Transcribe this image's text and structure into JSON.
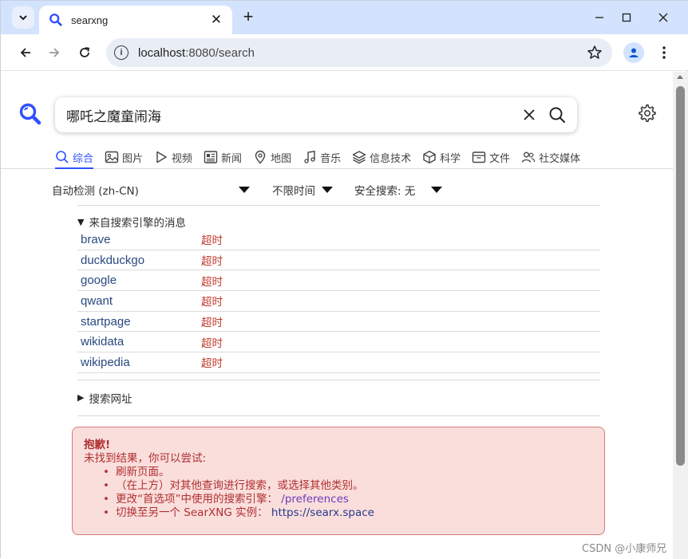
{
  "browser": {
    "tab_title": "searxng",
    "url_host": "localhost",
    "url_rest": ":8080/search"
  },
  "search": {
    "query": "哪吒之魔童闹海"
  },
  "categories": [
    {
      "label": "综合",
      "icon": "search-icon",
      "active": true
    },
    {
      "label": "图片",
      "icon": "image-icon"
    },
    {
      "label": "视频",
      "icon": "play-icon"
    },
    {
      "label": "新闻",
      "icon": "newspaper-icon"
    },
    {
      "label": "地图",
      "icon": "map-pin-icon"
    },
    {
      "label": "音乐",
      "icon": "music-icon"
    },
    {
      "label": "信息技术",
      "icon": "layers-icon"
    },
    {
      "label": "科学",
      "icon": "cube-icon"
    },
    {
      "label": "文件",
      "icon": "file-box-icon"
    },
    {
      "label": "社交媒体",
      "icon": "people-icon"
    }
  ],
  "filters": {
    "language": "自动检测 (zh-CN)",
    "time": "不限时间",
    "safesearch": "安全搜索: 无"
  },
  "engines": {
    "summary": "来自搜索引擎的消息",
    "rows": [
      {
        "name": "brave",
        "status": "超时"
      },
      {
        "name": "duckduckgo",
        "status": "超时"
      },
      {
        "name": "google",
        "status": "超时"
      },
      {
        "name": "qwant",
        "status": "超时"
      },
      {
        "name": "startpage",
        "status": "超时"
      },
      {
        "name": "wikidata",
        "status": "超时"
      },
      {
        "name": "wikipedia",
        "status": "超时"
      }
    ]
  },
  "search_url": {
    "summary": "搜索网址"
  },
  "alert": {
    "title": "抱歉!",
    "subtitle": "未找到结果，你可以尝试:",
    "items": [
      {
        "text": "刷新页面。"
      },
      {
        "text": "（在上方）对其他查询进行搜索，或选择其他类别。"
      },
      {
        "text": "更改“首选项”中使用的搜索引擎：",
        "link": "/preferences"
      },
      {
        "text": "切换至另一个 SearXNG 实例：",
        "link": "https://searx.space"
      }
    ]
  },
  "watermark": "CSDN @小康师兄",
  "colors": {
    "accent": "#3050ff",
    "engine_link": "#29497f",
    "error": "#c0392b",
    "alert_bg": "#f9dedc",
    "tabbar": "#d3e3fd"
  }
}
